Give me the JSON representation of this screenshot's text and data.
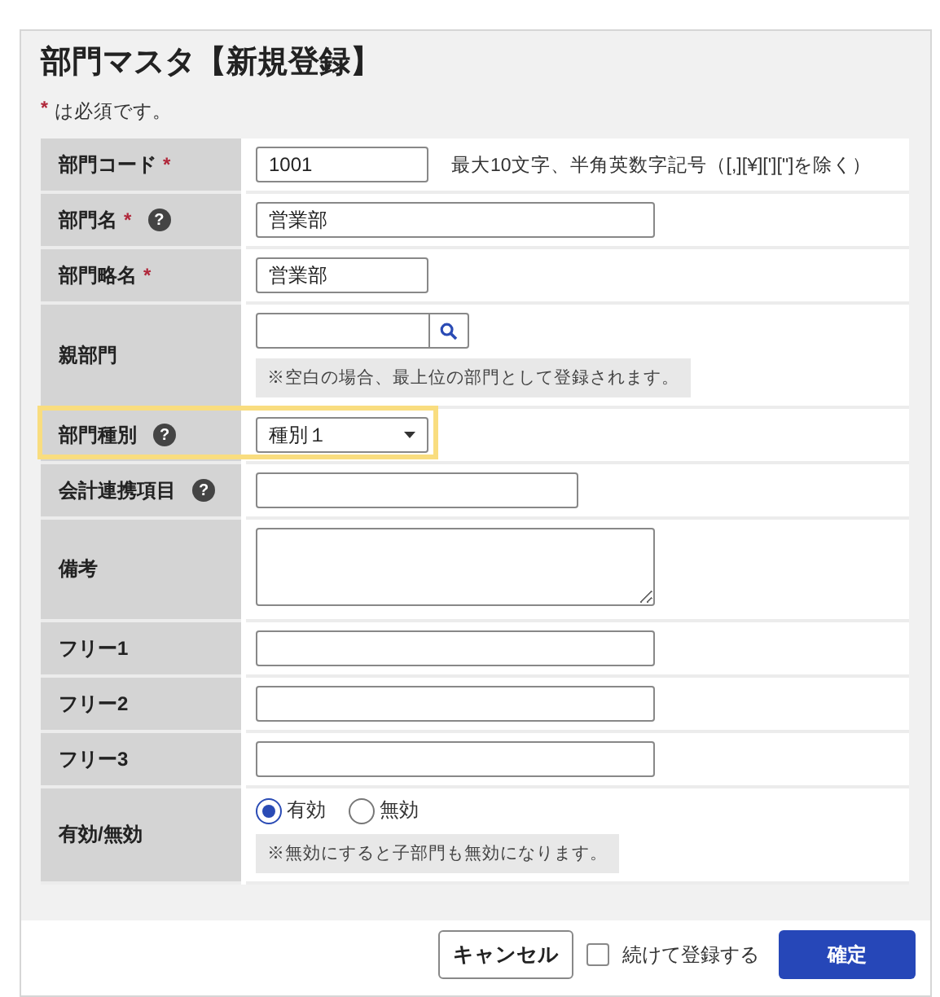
{
  "title": "部門マスタ【新規登録】",
  "required_note": {
    "mark": "*",
    "text": "は必須です。"
  },
  "rows": [
    {
      "label": "部門コード",
      "required": true,
      "highlighted": false,
      "control": {
        "kind": "short",
        "value": "1001"
      },
      "hint": "最大10文字、半角英数字記号（[,][¥]['][\"]を除く）"
    },
    {
      "label": "部門名",
      "required": true,
      "help": "?",
      "highlighted": false,
      "control": {
        "kind": "long",
        "value": "営業部"
      }
    },
    {
      "label": "部門略名",
      "required": true,
      "highlighted": false,
      "control": {
        "kind": "short",
        "value": "営業部"
      }
    },
    {
      "label": "親部門",
      "required": false,
      "highlighted": false,
      "control": {
        "kind": "search"
      },
      "note": "※空白の場合、最上位の部門として登録されます。"
    },
    {
      "label": "部門種別",
      "required": false,
      "help": "?",
      "highlighted": true,
      "control": {
        "kind": "select",
        "value": "種別１"
      }
    },
    {
      "label": "会計連携項目",
      "required": false,
      "help": "?",
      "highlighted": false,
      "control": {
        "kind": "medium"
      }
    },
    {
      "label": "備考",
      "required": false,
      "highlighted": false,
      "control": {
        "kind": "textarea"
      }
    },
    {
      "label": "フリー1",
      "required": false,
      "highlighted": false,
      "control": {
        "kind": "long"
      }
    },
    {
      "label": "フリー2",
      "required": false,
      "highlighted": false,
      "control": {
        "kind": "long"
      }
    },
    {
      "label": "フリー3",
      "required": false,
      "highlighted": false,
      "control": {
        "kind": "long"
      }
    },
    {
      "label": "有効/無効",
      "required": false,
      "highlighted": false,
      "control": {
        "kind": "radio",
        "options": [
          {
            "label": "有効",
            "selected": true
          },
          {
            "label": "無効",
            "selected": false
          }
        ]
      },
      "note": "※無効にすると子部門も無効になります。"
    }
  ],
  "footer": {
    "cancel": "キャンセル",
    "continue": {
      "label": "続けて登録する",
      "checked": false
    },
    "confirm": "確定"
  }
}
